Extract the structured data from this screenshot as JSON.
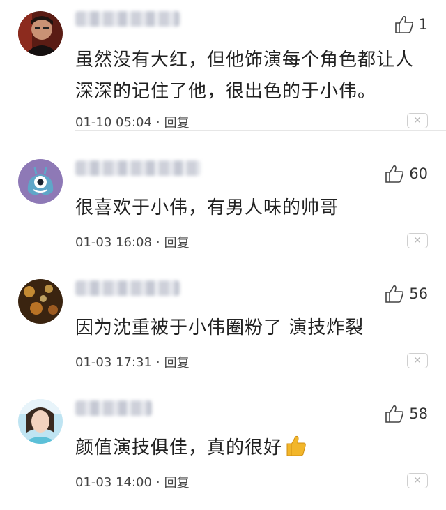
{
  "comments": [
    {
      "likes": "1",
      "text": "虽然没有大红，但他饰演每个角色都让人深深的记住了他，很出色的于小伟。",
      "time": "01-10 05:04",
      "reply_label": "回复",
      "close_glyph": "✕"
    },
    {
      "likes": "60",
      "text": "很喜欢于小伟，有男人味的帅哥",
      "time": "01-03 16:08",
      "reply_label": "回复",
      "close_glyph": "✕"
    },
    {
      "likes": "56",
      "text": "因为沈重被于小伟圈粉了 演技炸裂",
      "time": "01-03 17:31",
      "reply_label": "回复",
      "close_glyph": "✕"
    },
    {
      "likes": "58",
      "text": "颜值演技俱佳，真的很好",
      "time": "01-03 14:00",
      "reply_label": "回复",
      "close_glyph": "✕",
      "emoji": "thumbs-up-emoji"
    }
  ],
  "separator": "·",
  "colors": {
    "thumb_outline": "#444444",
    "emoji": "#f2b62a",
    "close": "#b8b8b8"
  },
  "icons": {
    "like": "thumbs-up-outline-icon",
    "close": "close-icon"
  }
}
